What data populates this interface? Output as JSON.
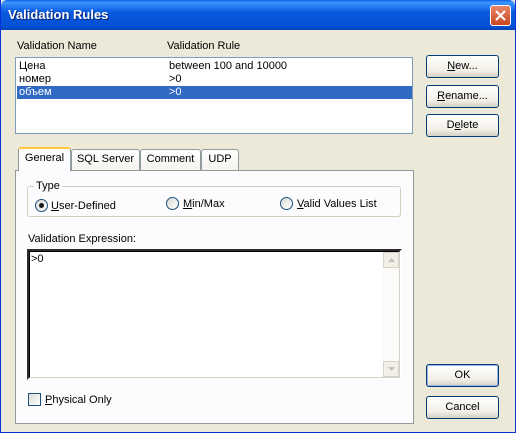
{
  "window": {
    "title": "Validation Rules"
  },
  "list": {
    "headers": {
      "name": "Validation Name",
      "rule": "Validation Rule"
    },
    "rows": [
      {
        "name": "Цена",
        "rule": "between 100 and 10000"
      },
      {
        "name": "номер",
        "rule": ">0"
      },
      {
        "name": "объем",
        "rule": ">0",
        "selected": true
      }
    ]
  },
  "side_buttons": {
    "new": {
      "u": "N",
      "rest": "ew..."
    },
    "rename": {
      "u": "R",
      "rest": "ename..."
    },
    "delete_pre": "D",
    "delete_u": "e",
    "delete_post": "lete"
  },
  "tabs": [
    "General",
    "SQL Server",
    "Comment",
    "UDP"
  ],
  "type_group": {
    "legend": "Type",
    "user_defined": {
      "u": "U",
      "rest": "ser-Defined"
    },
    "minmax": {
      "u": "M",
      "rest": "in/Max"
    },
    "valid_list": {
      "u": "V",
      "rest": "alid Values List"
    },
    "selected": "User-Defined"
  },
  "expression": {
    "label": "Validation Expression:",
    "value": ">0"
  },
  "physical_only": {
    "u": "P",
    "rest": "hysical Only",
    "checked": false
  },
  "ok_label": "OK",
  "cancel_label": "Cancel"
}
